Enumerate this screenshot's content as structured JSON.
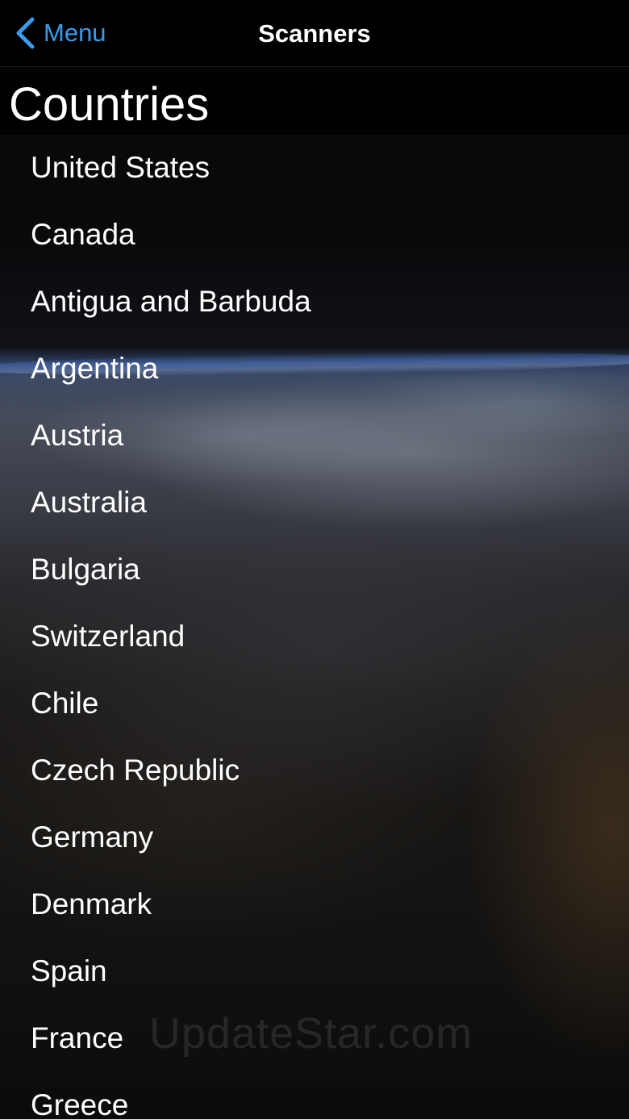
{
  "navbar": {
    "back_label": "Menu",
    "back_icon": "chevron-left-icon",
    "title": "Scanners",
    "accent_color": "#3a9bea"
  },
  "section": {
    "title": "Countries"
  },
  "countries": [
    "United States",
    "Canada",
    "Antigua and Barbuda",
    "Argentina",
    "Austria",
    "Australia",
    "Bulgaria",
    "Switzerland",
    "Chile",
    "Czech Republic",
    "Germany",
    "Denmark",
    "Spain",
    "France",
    "Greece"
  ],
  "watermark": "UpdateStar.com"
}
